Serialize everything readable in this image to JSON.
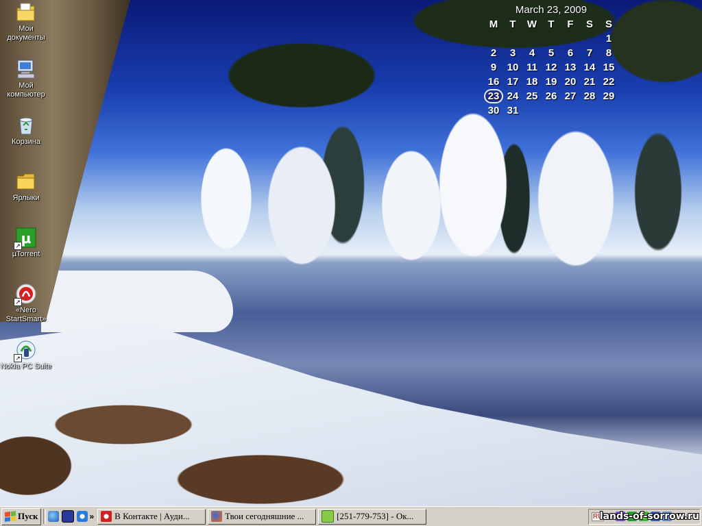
{
  "desktop_icons": [
    {
      "label": "Мои документы",
      "icon": "my-documents-icon"
    },
    {
      "label": "Мой компьютер",
      "icon": "my-computer-icon"
    },
    {
      "label": "Корзина",
      "icon": "recycle-bin-icon"
    },
    {
      "label": "Ярлыки",
      "icon": "folder-icon"
    },
    {
      "label": "µTorrent",
      "icon": "utorrent-icon"
    },
    {
      "label": "«Nero StartSmart»",
      "icon": "nero-icon"
    },
    {
      "label": "Nokia PC Suite",
      "icon": "nokia-pc-suite-icon"
    }
  ],
  "calendar": {
    "title": "March 23, 2009",
    "weekdays": [
      "M",
      "T",
      "W",
      "T",
      "F",
      "S",
      "S"
    ],
    "today": 23,
    "days": [
      "",
      "",
      "",
      "",
      "",
      "",
      "1",
      "2",
      "3",
      "4",
      "5",
      "6",
      "7",
      "8",
      "9",
      "10",
      "11",
      "12",
      "13",
      "14",
      "15",
      "16",
      "17",
      "18",
      "19",
      "20",
      "21",
      "22",
      "23",
      "24",
      "25",
      "26",
      "27",
      "28",
      "29",
      "30",
      "31",
      "",
      "",
      "",
      "",
      ""
    ]
  },
  "taskbar": {
    "start_label": "Пуск",
    "quick_launch": [
      "ie-icon",
      "save-icon",
      "outlook-express-icon"
    ],
    "chevron": "»",
    "tasks": [
      {
        "label": "В Контакте | Ауди...",
        "icon": "opera-icon"
      },
      {
        "label": "Твои сегодняшние ...",
        "icon": "firefox-icon"
      },
      {
        "label": "[251-779-753] - Ок...",
        "icon": "icq-window-icon"
      }
    ],
    "tray": {
      "lang": "RU",
      "chevron": "«",
      "clock": "21:20"
    }
  },
  "watermark": "lands-of-sorrow.ru",
  "colors": {
    "taskbar_bg": "#d4d0c8",
    "today_circle": "#1c2f8a"
  }
}
